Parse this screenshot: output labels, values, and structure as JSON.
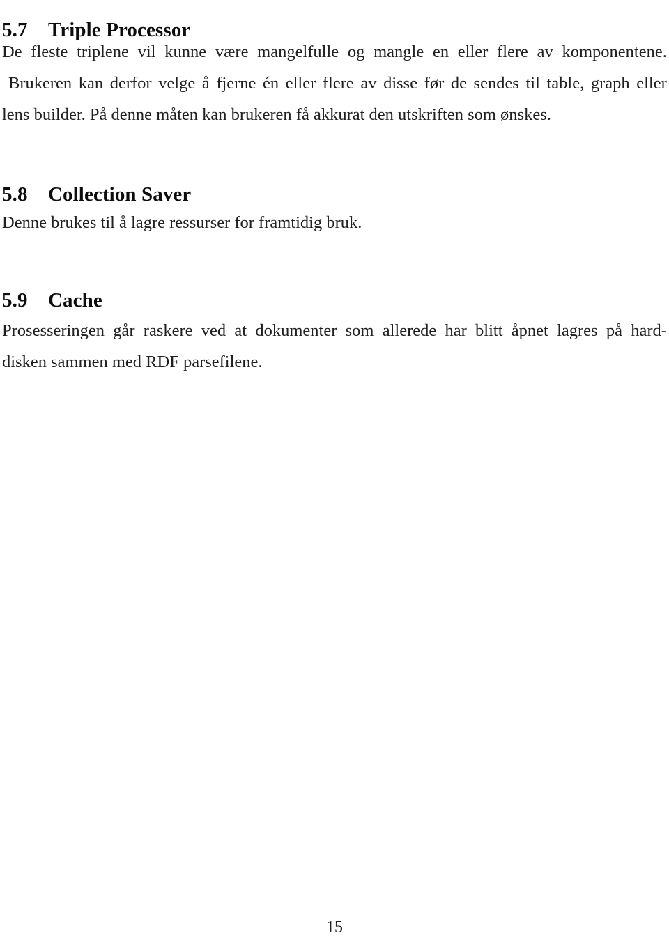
{
  "document": {
    "page_number": "15",
    "language": "Norwegian",
    "background_color": "#ffffff",
    "text_color": "#202020"
  },
  "sections": [
    {
      "number": "5.7",
      "title": "Triple Processor",
      "paragraphs": [
        {
          "full_text": "De fleste triplene vil kunne være mangelfulle og mangle en eller flere av komponentene. Brukeren kan derfor velge å fjerne én eller flere av disse før de sendes til table, graph eller lens builder. På denne måten kan brukeren få akkurat den utskriften som ønskes.",
          "lines": [
            "De fleste triplene vil kunne være mangelfulle og mangle en eller flere av komponentene.",
            "Brukeren kan derfor velge å fjerne én eller flere av disse før de sendes til table, graph eller",
            "lens builder. På denne måten kan brukeren få akkurat den utskriften som ønskes."
          ]
        }
      ]
    },
    {
      "number": "5.8",
      "title": "Collection Saver",
      "paragraphs": [
        {
          "full_text": "Denne brukes til å lagre ressurser for framtidig bruk.",
          "lines": [
            "Denne brukes til å lagre ressurser for framtidig bruk."
          ]
        }
      ]
    },
    {
      "number": "5.9",
      "title": "Cache",
      "paragraphs": [
        {
          "full_text": "Prosesseringen går raskere ved at dokumenter som allerede har blitt åpnet lagres på harddisken sammen med RDF parsefilene.",
          "lines": [
            "Prosesseringen går raskere ved at dokumenter som allerede har blitt åpnet lagres på hard-",
            "disken sammen med RDF parsefilene."
          ]
        }
      ]
    }
  ]
}
